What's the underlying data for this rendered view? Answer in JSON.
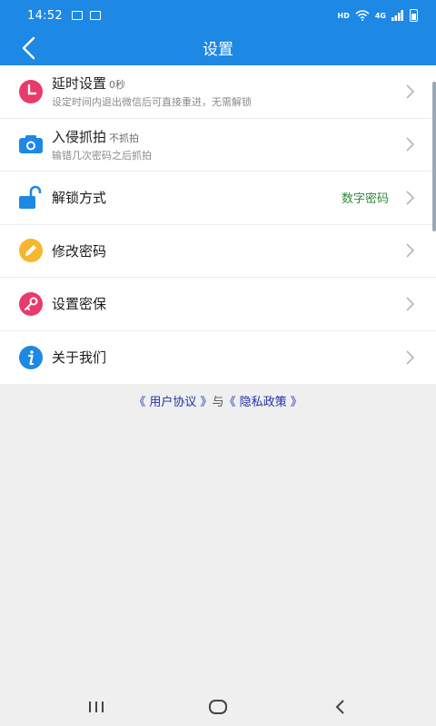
{
  "status": {
    "time": "14:52",
    "hd": "HD",
    "network": "4G"
  },
  "header": {
    "title": "设置"
  },
  "settings": [
    {
      "label": "延时设置",
      "value_inline": "0秒",
      "sub": "设定时间内退出微信后可直接重进，无需解锁",
      "icon": "clock-icon",
      "color": "#e83a6b"
    },
    {
      "label": "入侵抓拍",
      "value_inline": "不抓拍",
      "sub": "输错几次密码之后抓拍",
      "icon": "camera-icon",
      "color": "#1e88e5"
    },
    {
      "label": "解锁方式",
      "value_right": "数字密码",
      "icon": "unlock-icon",
      "color": "#1e88e5"
    },
    {
      "label": "修改密码",
      "icon": "pencil-icon",
      "color": "#f5b731"
    },
    {
      "label": "设置密保",
      "icon": "key-icon",
      "color": "#e83a6b"
    },
    {
      "label": "关于我们",
      "icon": "info-icon",
      "color": "#1e88e5"
    }
  ],
  "footer": {
    "agreement": "《 用户协议 》",
    "joiner": "与",
    "privacy": "《 隐私政策 》"
  }
}
